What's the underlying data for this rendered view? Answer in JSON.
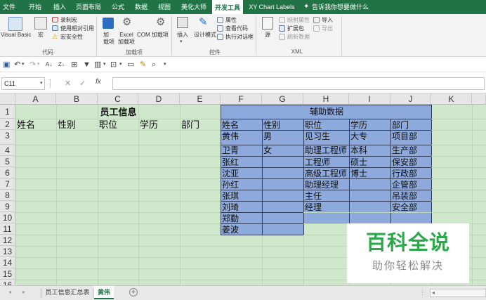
{
  "ribbon_tabs": [
    "文件",
    "开始",
    "插入",
    "页面布局",
    "公式",
    "数据",
    "视图",
    "美化大师",
    "开发工具",
    "XY Chart Labels"
  ],
  "active_tab": "开发工具",
  "tell_me": "告诉我你想要做什么",
  "ribbon": {
    "code": {
      "visual_basic": "Visual Basic",
      "macros": "宏",
      "record": "录制宏",
      "relative": "使用相对引用",
      "security": "宏安全性",
      "group": "代码"
    },
    "addins": {
      "addins": "加\n载项",
      "excel_addins": "Excel\n加载项",
      "com_addins": "COM 加载项",
      "group": "加载项"
    },
    "controls": {
      "insert": "插入",
      "design_mode": "设计模式",
      "properties": "属性",
      "view_code": "查看代码",
      "run_dialog": "执行对话框",
      "group": "控件"
    },
    "xml": {
      "source": "源",
      "map_props": "映射属性",
      "expansion": "扩展包",
      "refresh": "刷新数据",
      "import": "导入",
      "export": "导出",
      "group": "XML"
    }
  },
  "name_box": "C11",
  "formula_value": "",
  "columns": [
    "A",
    "B",
    "C",
    "D",
    "E",
    "F",
    "G",
    "H",
    "I",
    "J",
    "K"
  ],
  "rows": [
    "1",
    "2",
    "3",
    "4",
    "5",
    "6",
    "7",
    "8",
    "9",
    "10",
    "11",
    "12",
    "13",
    "14",
    "15",
    "16"
  ],
  "main_title": "员工信息",
  "main_headers": [
    "姓名",
    "性别",
    "职位",
    "学历",
    "部门"
  ],
  "aux_title": "辅助数据",
  "aux_headers": [
    "姓名",
    "性别",
    "职位",
    "学历",
    "部门"
  ],
  "aux_rows": [
    [
      "黄伟",
      "男",
      "见习生",
      "大专",
      "项目部"
    ],
    [
      "卫青",
      "女",
      "助理工程师",
      "本科",
      "生产部"
    ],
    [
      "张红",
      "",
      "工程师",
      "硕士",
      "保安部"
    ],
    [
      "沈亚",
      "",
      "高级工程师",
      "博士",
      "行政部"
    ],
    [
      "孙红",
      "",
      "助理经理",
      "",
      "企管部"
    ],
    [
      "张琪",
      "",
      "主任",
      "",
      "吊装部"
    ],
    [
      "刘琦",
      "",
      "经理",
      "",
      "安全部"
    ],
    [
      "郑勤",
      "",
      "",
      "",
      ""
    ],
    [
      "姜波",
      "",
      "",
      "",
      ""
    ]
  ],
  "sheet_tabs": [
    "员工信息汇总表",
    "黄伟"
  ],
  "active_sheet": "黄伟",
  "watermark": {
    "title": "百科全说",
    "subtitle": "助你轻松解决"
  },
  "colors": {
    "excel_green": "#217346",
    "green_fill": "#cfe8cb",
    "blue_fill": "#8ea9db"
  }
}
